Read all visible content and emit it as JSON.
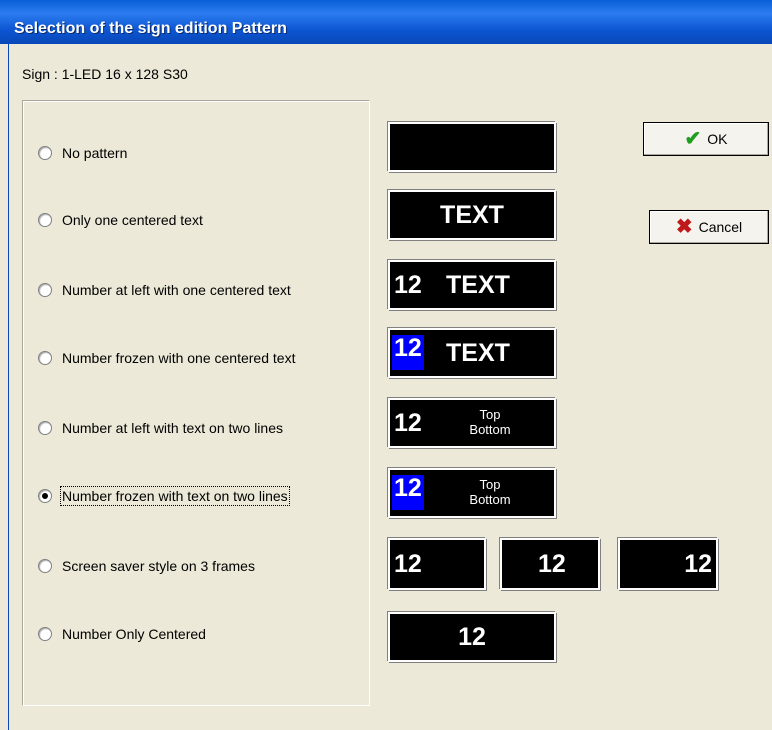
{
  "window": {
    "title": "Selection of the sign edition Pattern"
  },
  "sign_label": "Sign : 1-LED 16 x 128 S30",
  "options": [
    {
      "label": "No pattern",
      "checked": false
    },
    {
      "label": "Only one centered text",
      "checked": false
    },
    {
      "label": "Number at left with one centered text",
      "checked": false
    },
    {
      "label": "Number frozen with one centered text",
      "checked": false
    },
    {
      "label": "Number at left with text on two lines",
      "checked": false
    },
    {
      "label": "Number frozen with text on two lines",
      "checked": true
    },
    {
      "label": "Screen saver style on 3 frames",
      "checked": false
    },
    {
      "label": "Number Only Centered",
      "checked": false
    }
  ],
  "previews": {
    "text": "TEXT",
    "number": "12",
    "top": "Top",
    "bottom": "Bottom"
  },
  "buttons": {
    "ok": {
      "label": "OK",
      "icon": "checkmark-icon",
      "icon_color": "#1e9e1e"
    },
    "cancel": {
      "label": "Cancel",
      "icon": "x-icon",
      "icon_color": "#c01818"
    }
  },
  "colors": {
    "frozen_number_bg": "#0000ff",
    "sign_bg": "#000000"
  }
}
